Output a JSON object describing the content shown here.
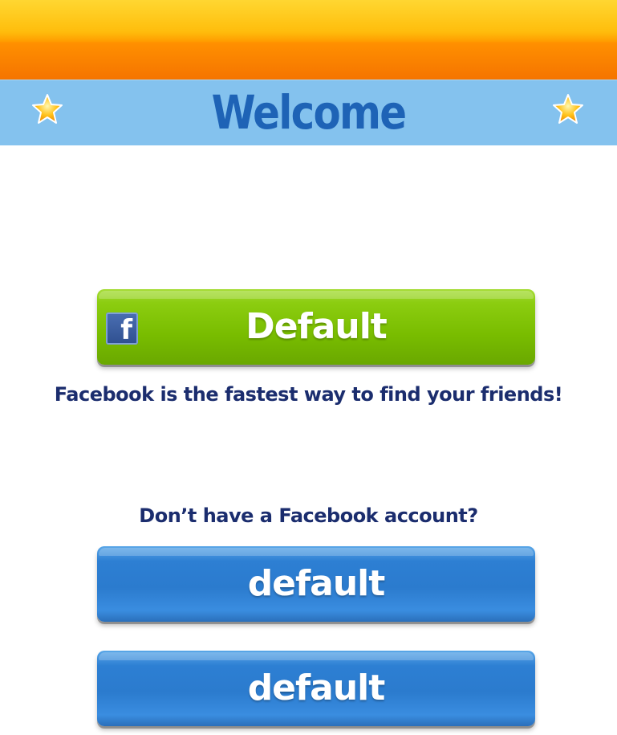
{
  "header": {
    "title": "Welcome",
    "left_icon": "star-icon",
    "right_icon": "star-icon"
  },
  "facebook": {
    "button_label": "Default",
    "icon": "facebook-icon",
    "icon_glyph": "f",
    "caption": "Facebook is the fastest way to find your friends!"
  },
  "no_account": {
    "caption": "Don’t have a Facebook account?",
    "button_1_label": "default",
    "button_2_label": "default"
  },
  "colors": {
    "top_bar": "#ff9a00",
    "header_band": "#84c2ee",
    "title": "#1e63b6",
    "green_button": "#7cc000",
    "blue_button": "#2e7fd2",
    "caption_text": "#1b2d6e"
  }
}
